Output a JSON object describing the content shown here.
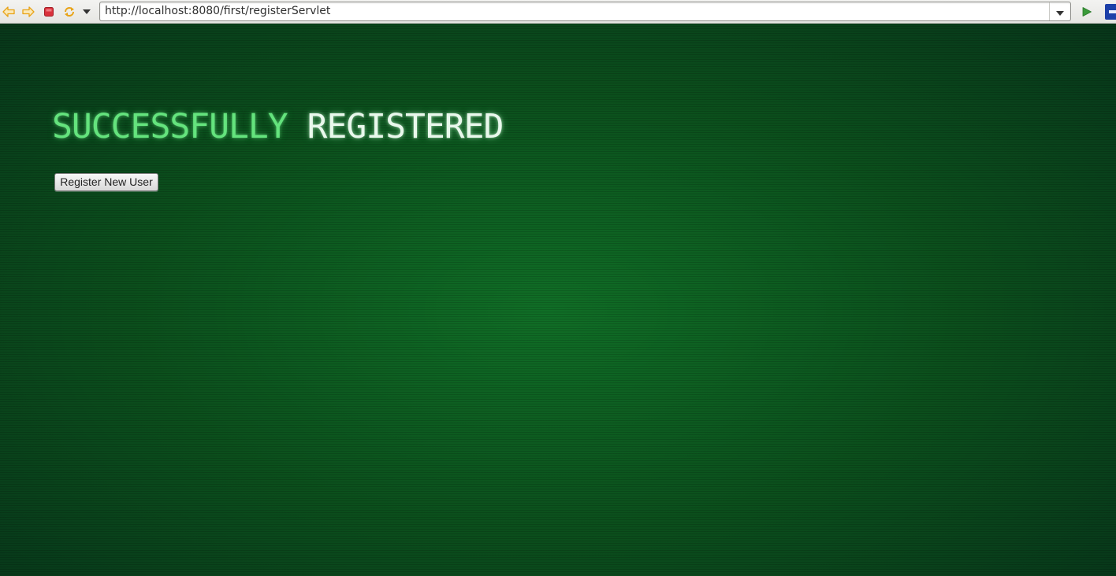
{
  "browser": {
    "url": "http://localhost:8080/first/registerServlet",
    "icons": {
      "back": "back-arrow-icon",
      "forward": "forward-arrow-icon",
      "stop": "stop-icon",
      "reload": "reload-icon",
      "history": "chevron-down-icon",
      "url_dropdown": "chevron-down-icon",
      "go": "play-icon",
      "extension": "extension-icon"
    },
    "colors": {
      "back_forward": "#e8a317",
      "stop": "#d9323c",
      "go": "#3a9a3a"
    }
  },
  "page": {
    "heading_word1": "SUCCESSFULLY",
    "heading_word2": "REGISTERED",
    "register_button_label": "Register New User",
    "colors": {
      "background": "#0b4e1c",
      "heading_green": "#64e37d",
      "heading_white": "#e9f8ec"
    }
  }
}
